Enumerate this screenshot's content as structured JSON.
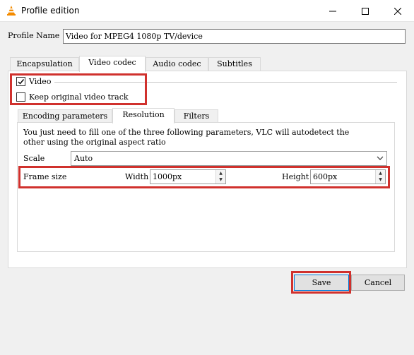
{
  "window": {
    "title": "Profile edition",
    "controls": {
      "minimize": "—",
      "maximize": "☐",
      "close": "✕"
    }
  },
  "profile": {
    "label": "Profile Name",
    "value": "Video for MPEG4 1080p TV/device"
  },
  "tabs": [
    {
      "label": "Encapsulation",
      "active": false
    },
    {
      "label": "Video codec",
      "active": true
    },
    {
      "label": "Audio codec",
      "active": false
    },
    {
      "label": "Subtitles",
      "active": false
    }
  ],
  "video": {
    "enable_label": "Video",
    "enable_checked": true,
    "keep_label": "Keep original video track",
    "keep_checked": false
  },
  "inner_tabs": [
    {
      "label": "Encoding parameters",
      "active": false
    },
    {
      "label": "Resolution",
      "active": true
    },
    {
      "label": "Filters",
      "active": false
    }
  ],
  "resolution": {
    "hint": "You just need to fill one of the three following parameters, VLC will autodetect the",
    "hint2": "other using the original aspect ratio",
    "scale_label": "Scale",
    "scale_value": "Auto",
    "frame_size_label": "Frame size",
    "width_label": "Width",
    "width_value": "1000px",
    "height_label": "Height",
    "height_value": "600px"
  },
  "buttons": {
    "save": "Save",
    "cancel": "Cancel"
  },
  "colors": {
    "highlight": "#d0312d",
    "vlc_orange": "#f48b00"
  }
}
